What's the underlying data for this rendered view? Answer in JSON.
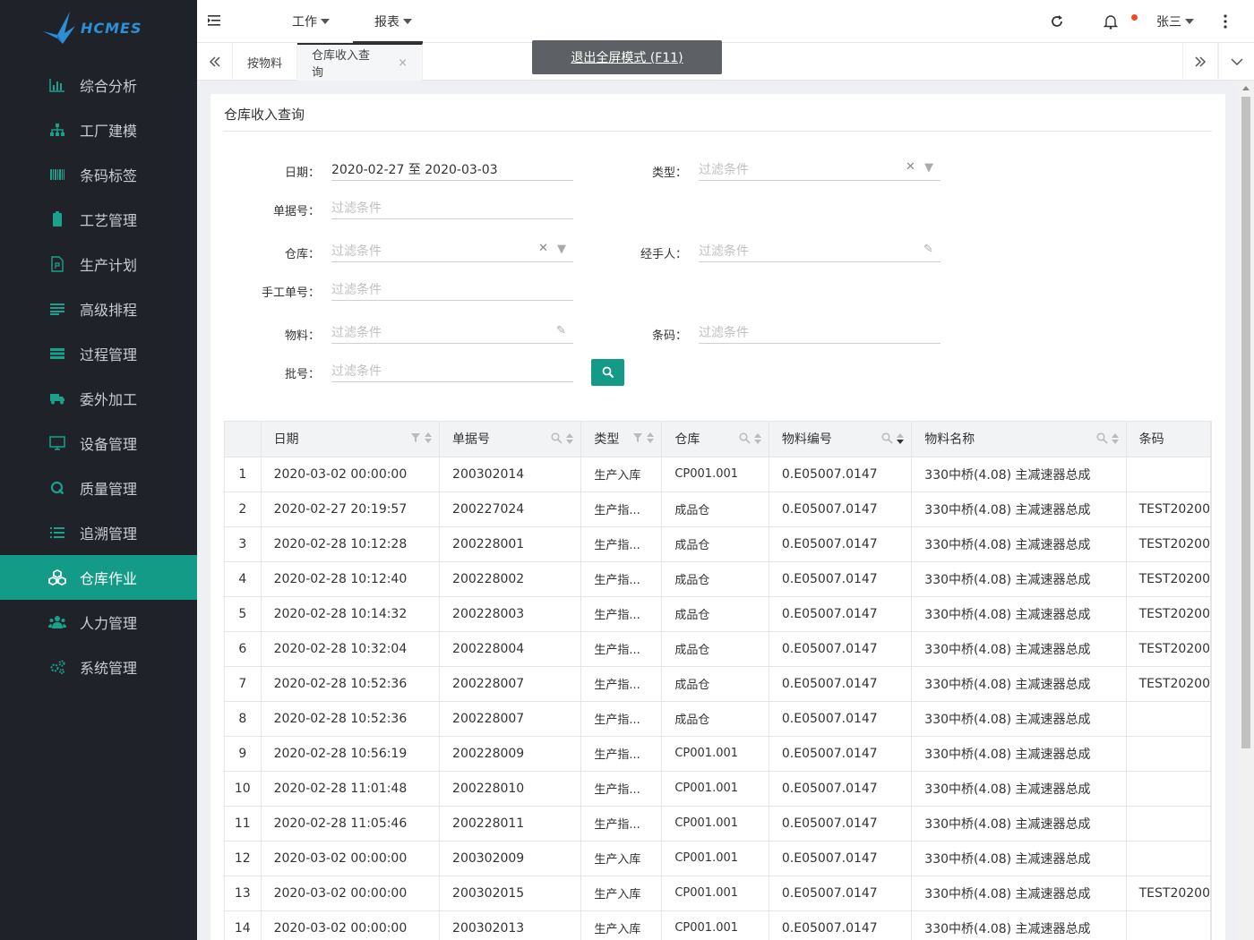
{
  "app": {
    "logo_text": "HCMES"
  },
  "sidebar": {
    "items": [
      {
        "label": "综合分析",
        "icon": "bar-chart-icon"
      },
      {
        "label": "工厂建模",
        "icon": "sitemap-icon"
      },
      {
        "label": "条码标签",
        "icon": "barcode-icon"
      },
      {
        "label": "工艺管理",
        "icon": "battery-icon"
      },
      {
        "label": "生产计划",
        "icon": "file-plan-icon"
      },
      {
        "label": "高级排程",
        "icon": "schedule-icon"
      },
      {
        "label": "过程管理",
        "icon": "list-icon"
      },
      {
        "label": "委外加工",
        "icon": "truck-icon"
      },
      {
        "label": "设备管理",
        "icon": "monitor-icon"
      },
      {
        "label": "质量管理",
        "icon": "quality-icon"
      },
      {
        "label": "追溯管理",
        "icon": "tracking-list-icon"
      },
      {
        "label": "仓库作业",
        "icon": "cubes-icon",
        "active": true
      },
      {
        "label": "人力管理",
        "icon": "users-icon"
      },
      {
        "label": "系统管理",
        "icon": "gears-icon"
      }
    ]
  },
  "header": {
    "nav": [
      {
        "label": "工作"
      },
      {
        "label": "报表"
      }
    ],
    "user": "张三"
  },
  "tabs": {
    "items": [
      {
        "label": "按物料"
      },
      {
        "label": "仓库收入查询",
        "active": true,
        "close": "×"
      }
    ],
    "fullscreen_label": "退出全屏模式 (F11)"
  },
  "panel": {
    "title": "仓库收入查询",
    "form": {
      "date_label": "日期：",
      "date_value": "2020-02-27 至 2020-03-03",
      "type_label": "类型：",
      "doc_label": "单据号：",
      "warehouse_label": "仓库：",
      "handler_label": "经手人：",
      "manual_label": "手工单号：",
      "material_label": "物料：",
      "barcode_label": "条码：",
      "batch_label": "批号：",
      "placeholder": "过滤条件"
    }
  },
  "table": {
    "columns": [
      "",
      "日期",
      "单据号",
      "类型",
      "仓库",
      "物料编号",
      "物料名称",
      "条码"
    ],
    "rows": [
      [
        "1",
        "2020-03-02 00:00:00",
        "200302014",
        "生产入库",
        "CP001.001",
        "0.E05007.0147",
        "330中桥(4.08) 主减速器总成",
        ""
      ],
      [
        "2",
        "2020-02-27 20:19:57",
        "200227024",
        "生产指...",
        "成品仓",
        "0.E05007.0147",
        "330中桥(4.08) 主减速器总成",
        "TEST20200"
      ],
      [
        "3",
        "2020-02-28 10:12:28",
        "200228001",
        "生产指...",
        "成品仓",
        "0.E05007.0147",
        "330中桥(4.08) 主减速器总成",
        "TEST20200"
      ],
      [
        "4",
        "2020-02-28 10:12:40",
        "200228002",
        "生产指...",
        "成品仓",
        "0.E05007.0147",
        "330中桥(4.08) 主减速器总成",
        "TEST20200"
      ],
      [
        "5",
        "2020-02-28 10:14:32",
        "200228003",
        "生产指...",
        "成品仓",
        "0.E05007.0147",
        "330中桥(4.08) 主减速器总成",
        "TEST20200"
      ],
      [
        "6",
        "2020-02-28 10:32:04",
        "200228004",
        "生产指...",
        "成品仓",
        "0.E05007.0147",
        "330中桥(4.08) 主减速器总成",
        "TEST20200"
      ],
      [
        "7",
        "2020-02-28 10:52:36",
        "200228007",
        "生产指...",
        "成品仓",
        "0.E05007.0147",
        "330中桥(4.08) 主减速器总成",
        "TEST20200"
      ],
      [
        "8",
        "2020-02-28 10:52:36",
        "200228007",
        "生产指...",
        "成品仓",
        "0.E05007.0147",
        "330中桥(4.08) 主减速器总成",
        ""
      ],
      [
        "9",
        "2020-02-28 10:56:19",
        "200228009",
        "生产指...",
        "CP001.001",
        "0.E05007.0147",
        "330中桥(4.08) 主减速器总成",
        ""
      ],
      [
        "10",
        "2020-02-28 11:01:48",
        "200228010",
        "生产指...",
        "CP001.001",
        "0.E05007.0147",
        "330中桥(4.08) 主减速器总成",
        ""
      ],
      [
        "11",
        "2020-02-28 11:05:46",
        "200228011",
        "生产指...",
        "CP001.001",
        "0.E05007.0147",
        "330中桥(4.08) 主减速器总成",
        ""
      ],
      [
        "12",
        "2020-03-02 00:00:00",
        "200302009",
        "生产入库",
        "CP001.001",
        "0.E05007.0147",
        "330中桥(4.08) 主减速器总成",
        ""
      ],
      [
        "13",
        "2020-03-02 00:00:00",
        "200302015",
        "生产入库",
        "CP001.001",
        "0.E05007.0147",
        "330中桥(4.08) 主减速器总成",
        "TEST20200"
      ],
      [
        "14",
        "2020-03-02 00:00:00",
        "200302013",
        "生产入库",
        "CP001.001",
        "0.E05007.0147",
        "330中桥(4.08) 主减速器总成",
        ""
      ]
    ]
  },
  "colors": {
    "sidebar_bg": "#1f2329",
    "accent": "#149b88",
    "notify": "#f04b1f"
  }
}
